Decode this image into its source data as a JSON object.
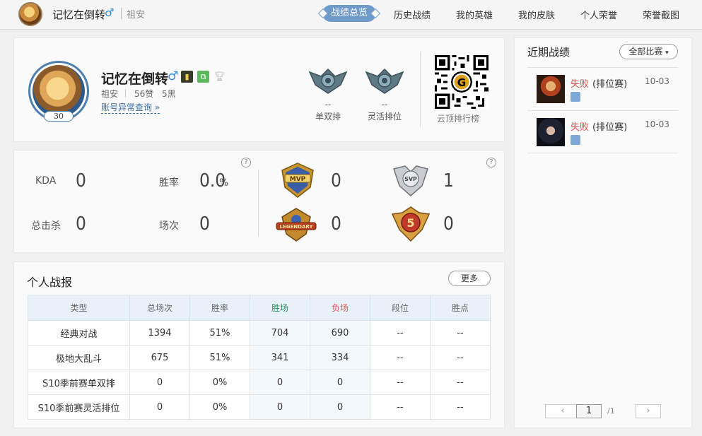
{
  "header": {
    "username": "记忆在倒转",
    "gender_symbol": "♂",
    "server": "祖安",
    "nav": [
      {
        "label": "战绩总览",
        "active": true
      },
      {
        "label": "历史战绩"
      },
      {
        "label": "我的英雄"
      },
      {
        "label": "我的皮肤"
      },
      {
        "label": "个人荣誉"
      },
      {
        "label": "荣誉截图"
      }
    ]
  },
  "profile": {
    "name": "记忆在倒转",
    "gender_symbol": "♂",
    "level": "30",
    "server": "祖安",
    "likes": "56赞",
    "blacks": "5黑",
    "account_link": "账号异常查询 »",
    "ranks": [
      {
        "value": "--",
        "label": "单双排"
      },
      {
        "value": "--",
        "label": "灵活排位"
      }
    ],
    "qr_label": "云顶排行榜"
  },
  "stats": {
    "kda_label": "KDA",
    "kda_value": "0",
    "winrate_label": "胜率",
    "winrate_value": "0.0",
    "winrate_unit": "%",
    "kills_label": "总击杀",
    "kills_value": "0",
    "games_label": "场次",
    "games_value": "0",
    "help": "?",
    "awards": [
      {
        "icon": "mvp-award-icon",
        "text": "MVP",
        "value": "0"
      },
      {
        "icon": "svp-award-icon",
        "text": "SVP",
        "value": "1"
      },
      {
        "icon": "legendary-award-icon",
        "text": "LEGENDARY",
        "value": "0"
      },
      {
        "icon": "pentakill-award-icon",
        "text": "5",
        "value": "0"
      }
    ]
  },
  "report": {
    "title": "个人战报",
    "more_label": "更多",
    "columns": [
      "类型",
      "总场次",
      "胜率",
      "胜场",
      "负场",
      "段位",
      "胜点"
    ],
    "rows": [
      [
        "经典对战",
        "1394",
        "51%",
        "704",
        "690",
        "--",
        "--"
      ],
      [
        "极地大乱斗",
        "675",
        "51%",
        "341",
        "334",
        "--",
        "--"
      ],
      [
        "S10季前赛单双排",
        "0",
        "0%",
        "0",
        "0",
        "--",
        "--"
      ],
      [
        "S10季前赛灵活排位",
        "0",
        "0%",
        "0",
        "0",
        "--",
        "--"
      ]
    ]
  },
  "recent": {
    "title": "近期战绩",
    "filter_label": "全部比赛",
    "matches": [
      {
        "result": "失败",
        "type": "(排位赛)",
        "date": "10-03"
      },
      {
        "result": "失败",
        "type": "(排位赛)",
        "date": "10-03"
      }
    ],
    "pagination": {
      "prev": "‹",
      "current": "1",
      "total": "/1",
      "next": "›"
    }
  },
  "colors": {
    "accent": "#6f9bcb",
    "win": "#2e8b57",
    "loss": "#d9534f",
    "link": "#3b6fa5"
  }
}
